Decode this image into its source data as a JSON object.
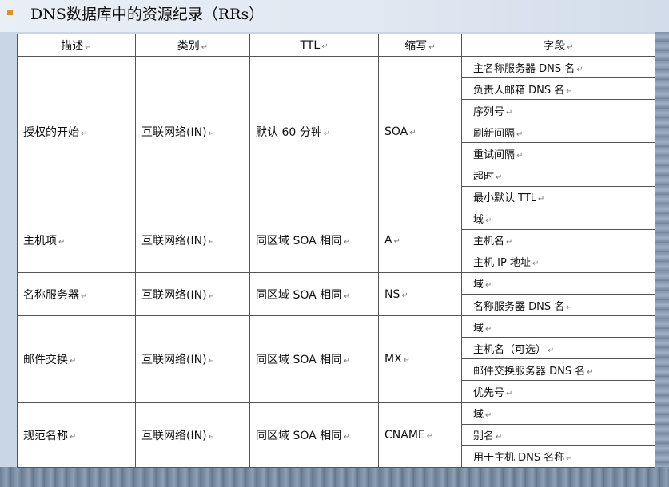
{
  "title": "DNS数据库中的资源纪录（RRs）",
  "headers": [
    "描述",
    "类别",
    "TTL",
    "缩写",
    "字段"
  ],
  "records": [
    {
      "desc": "授权的开始",
      "class": "互联网络(IN)",
      "ttl": "默认 60 分钟",
      "abbr": "SOA",
      "fields": [
        "主名称服务器 DNS 名",
        "负责人邮箱 DNS 名",
        "序列号",
        "刷新间隔",
        "重试间隔",
        "超时",
        "最小默认 TTL"
      ]
    },
    {
      "desc": "主机项",
      "class": "互联网络(IN)",
      "ttl": "同区域 SOA 相同",
      "abbr": "A",
      "fields": [
        "域",
        "主机名",
        "主机 IP 地址"
      ]
    },
    {
      "desc": "名称服务器",
      "class": "互联网络(IN)",
      "ttl": "同区域 SOA 相同",
      "abbr": "NS",
      "fields": [
        "域",
        "名称服务器 DNS 名"
      ]
    },
    {
      "desc": "邮件交换",
      "class": "互联网络(IN)",
      "ttl": "同区域 SOA 相同",
      "abbr": "MX",
      "fields": [
        "域",
        "主机名（可选）",
        "邮件交换服务器 DNS 名",
        "优先号"
      ]
    },
    {
      "desc": "规范名称",
      "class": "互联网络(IN)",
      "ttl": "同区域 SOA 相同",
      "abbr": "CNAME",
      "fields": [
        "域",
        "别名",
        "用于主机 DNS 名称"
      ]
    }
  ]
}
